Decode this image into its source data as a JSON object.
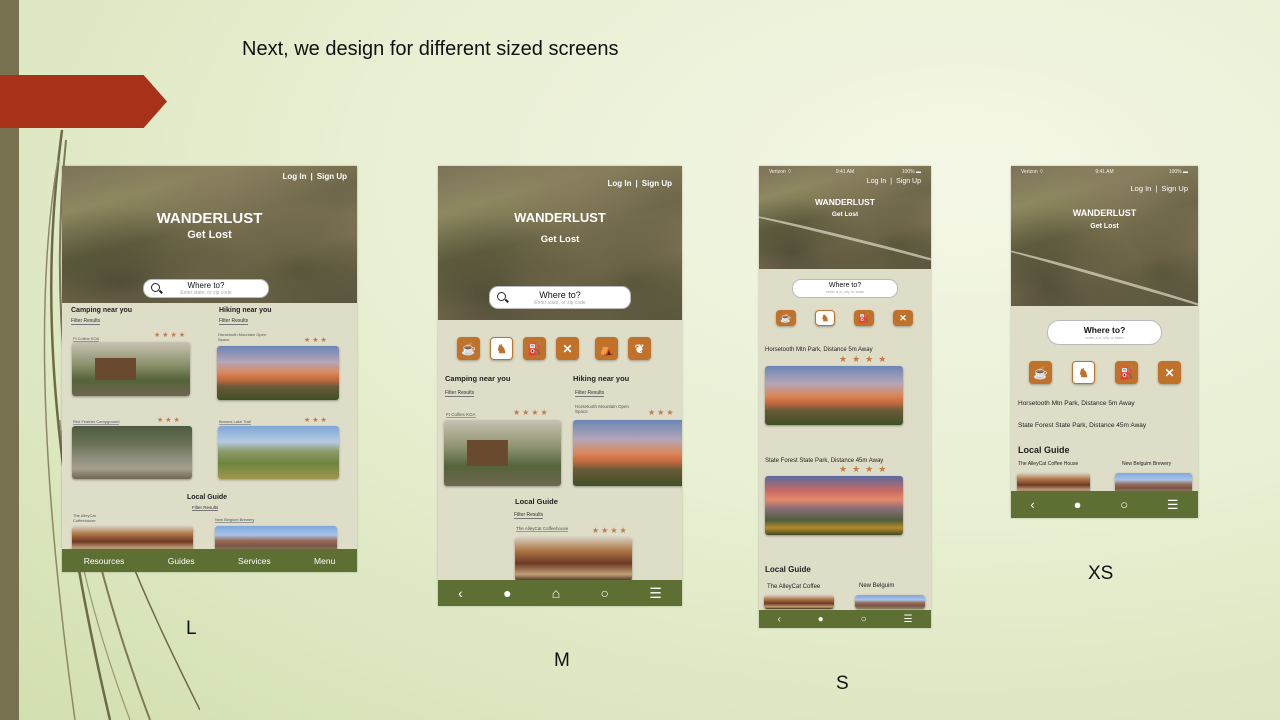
{
  "slide": {
    "title": "Next, we design for different sized screens",
    "labels": {
      "l": "L",
      "m": "M",
      "s": "S",
      "xs": "XS"
    }
  },
  "common": {
    "login": "Log In",
    "signup": "Sign Up",
    "brand": "WANDERLUST",
    "tagline": "Get Lost",
    "search_label": "Where to?",
    "search_placeholder": "Enter state, or zip code",
    "search_placeholder_small": "enter a a, city or state",
    "camping": "Camping near you",
    "hiking": "Hiking near you",
    "local_guide": "Local Guide",
    "filter": "Filter Results",
    "stars": "★★★★",
    "stars_three": "★★★"
  },
  "phone_status": {
    "carrier": "Verizon ⌔",
    "time": "9:41 AM",
    "battery": "100% ▬"
  },
  "large": {
    "places": [
      "Ft Collins KOA",
      "Horsetooth Mountain Open Space",
      "Red Feather Campground",
      "Browns Lake Trail",
      "The AlleyCat Coffeehouse",
      "New Belgium Brewery"
    ],
    "nav": [
      "Resources",
      "Guides",
      "Services",
      "Menu"
    ]
  },
  "medium": {
    "places": [
      "Ft Collins KOA",
      "Horsetooth Mountain Open Space",
      "The AlleyCat Coffeehouse"
    ],
    "icons": [
      "coffee-icon",
      "hiker-icon",
      "gas-pump-icon",
      "restaurant-icon",
      "tent-icon",
      "leaf-icon"
    ]
  },
  "small": {
    "park1": "Horsetooth Mtn Park,  Distance 5m Away",
    "park2": "State Forest State Park, Distance 45m Away",
    "guide1": "The AlleyCat Coffee",
    "guide2": "New Belguim"
  },
  "xsmall": {
    "park1": "Horsetooth Mtn Park,  Distance 5m Away",
    "park2": "State Forest State Park, Distance 45m Away",
    "guide1": "The AlleyCat Coffee House",
    "guide2": "New Belguim Brewery"
  },
  "colors": {
    "accent": "#c0722a",
    "nav": "#5d6f32",
    "screen_bg": "#deddc8",
    "arrow": "#a8311a",
    "side_bar": "#77714f"
  }
}
